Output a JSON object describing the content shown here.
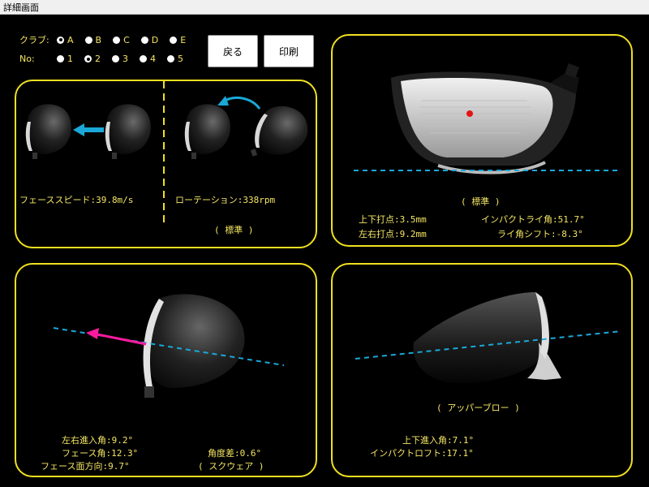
{
  "window": {
    "title": "詳細画面"
  },
  "selector": {
    "club_label": "クラブ:",
    "no_label": "No:",
    "clubs": [
      "A",
      "B",
      "C",
      "D",
      "E"
    ],
    "club_selected": "A",
    "numbers": [
      "1",
      "2",
      "3",
      "4",
      "5"
    ],
    "number_selected": "2"
  },
  "buttons": {
    "back": "戻る",
    "print": "印刷"
  },
  "panel_speed": {
    "face_speed_label": "フェーススピード:39.8m/s",
    "rotation_label": "ローテーション:338rpm",
    "rating": "( 標準 )"
  },
  "panel_impact": {
    "rating": "( 標準 )",
    "vertical_point": "上下打点:3.5mm",
    "horizontal_point": "左右打点:9.2mm",
    "impact_lie": "インパクトライ角:51.7°",
    "lie_shift": "ライ角シフト:-8.3°"
  },
  "panel_approach": {
    "lr_angle": "左右進入角:9.2°",
    "face_angle": "フェース角:12.3°",
    "face_direction": "フェース面方向:9.7°",
    "angle_diff": "角度差:0.6°",
    "rating": "( スクウェア )"
  },
  "panel_upper": {
    "rating": "( アッパーブロー )",
    "vertical_angle": "上下進入角:7.1°",
    "impact_loft": "インパクトロフト:17.1°"
  },
  "colors": {
    "panel_border": "#f0e020",
    "text": "#f5e663",
    "accent_blue": "#1aa8d8",
    "arrow_pink": "#ff1aa0"
  }
}
